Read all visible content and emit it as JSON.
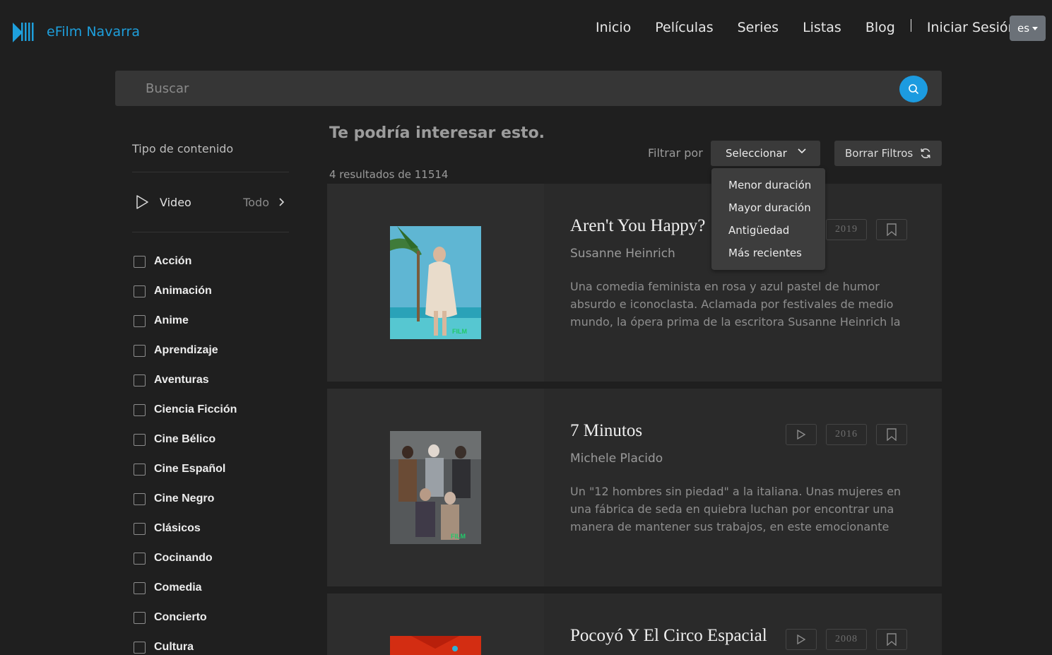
{
  "brand": {
    "name": "eFilm Navarra"
  },
  "nav": {
    "items": [
      "Inicio",
      "Películas",
      "Series",
      "Listas",
      "Blog"
    ],
    "login": "Iniciar Sesión",
    "lang": "es"
  },
  "search": {
    "placeholder": "Buscar"
  },
  "sidebar": {
    "title": "Tipo de contenido",
    "video": {
      "label": "Video",
      "value": "Todo"
    },
    "genres": [
      "Acción",
      "Animación",
      "Anime",
      "Aprendizaje",
      "Aventuras",
      "Ciencia Ficción",
      "Cine Bélico",
      "Cine Español",
      "Cine Negro",
      "Clásicos",
      "Cocinando",
      "Comedia",
      "Concierto",
      "Cultura"
    ]
  },
  "main": {
    "title": "Te podría interesar esto.",
    "results": "4 resultados de 11514",
    "filter_label": "Filtrar por",
    "select_label": "Seleccionar",
    "clear_label": "Borrar Filtros",
    "sort_options": [
      "Menor duración",
      "Mayor duración",
      "Antigüedad",
      "Más recientes"
    ]
  },
  "cards": [
    {
      "title": "Aren't You Happy?",
      "director": "Susanne Heinrich",
      "year": "2019",
      "desc": "Una comedia feminista en rosa y azul pastel de humor absurdo e iconoclasta. Aclamada por festivales de medio mundo, la ópera prima de la escritora Susanne Heinrich la ...",
      "poster_badge": "FILM"
    },
    {
      "title": "7 Minutos",
      "director": "Michele Placido",
      "year": "2016",
      "desc": "Un \"12 hombres sin piedad\" a la italiana. Unas mujeres en una fábrica de seda en quiebra luchan por encontrar una manera de mantener sus trabajos, en este emocionante ...",
      "poster_badge": "FILM"
    },
    {
      "title": "Pocoyó Y El Circo Espacial",
      "director": "",
      "year": "2008",
      "desc": "",
      "poster_badge": ""
    }
  ],
  "colors": {
    "accent": "#1e9fdc",
    "background": "#1f1f1f",
    "card": "#2a2a2a"
  }
}
